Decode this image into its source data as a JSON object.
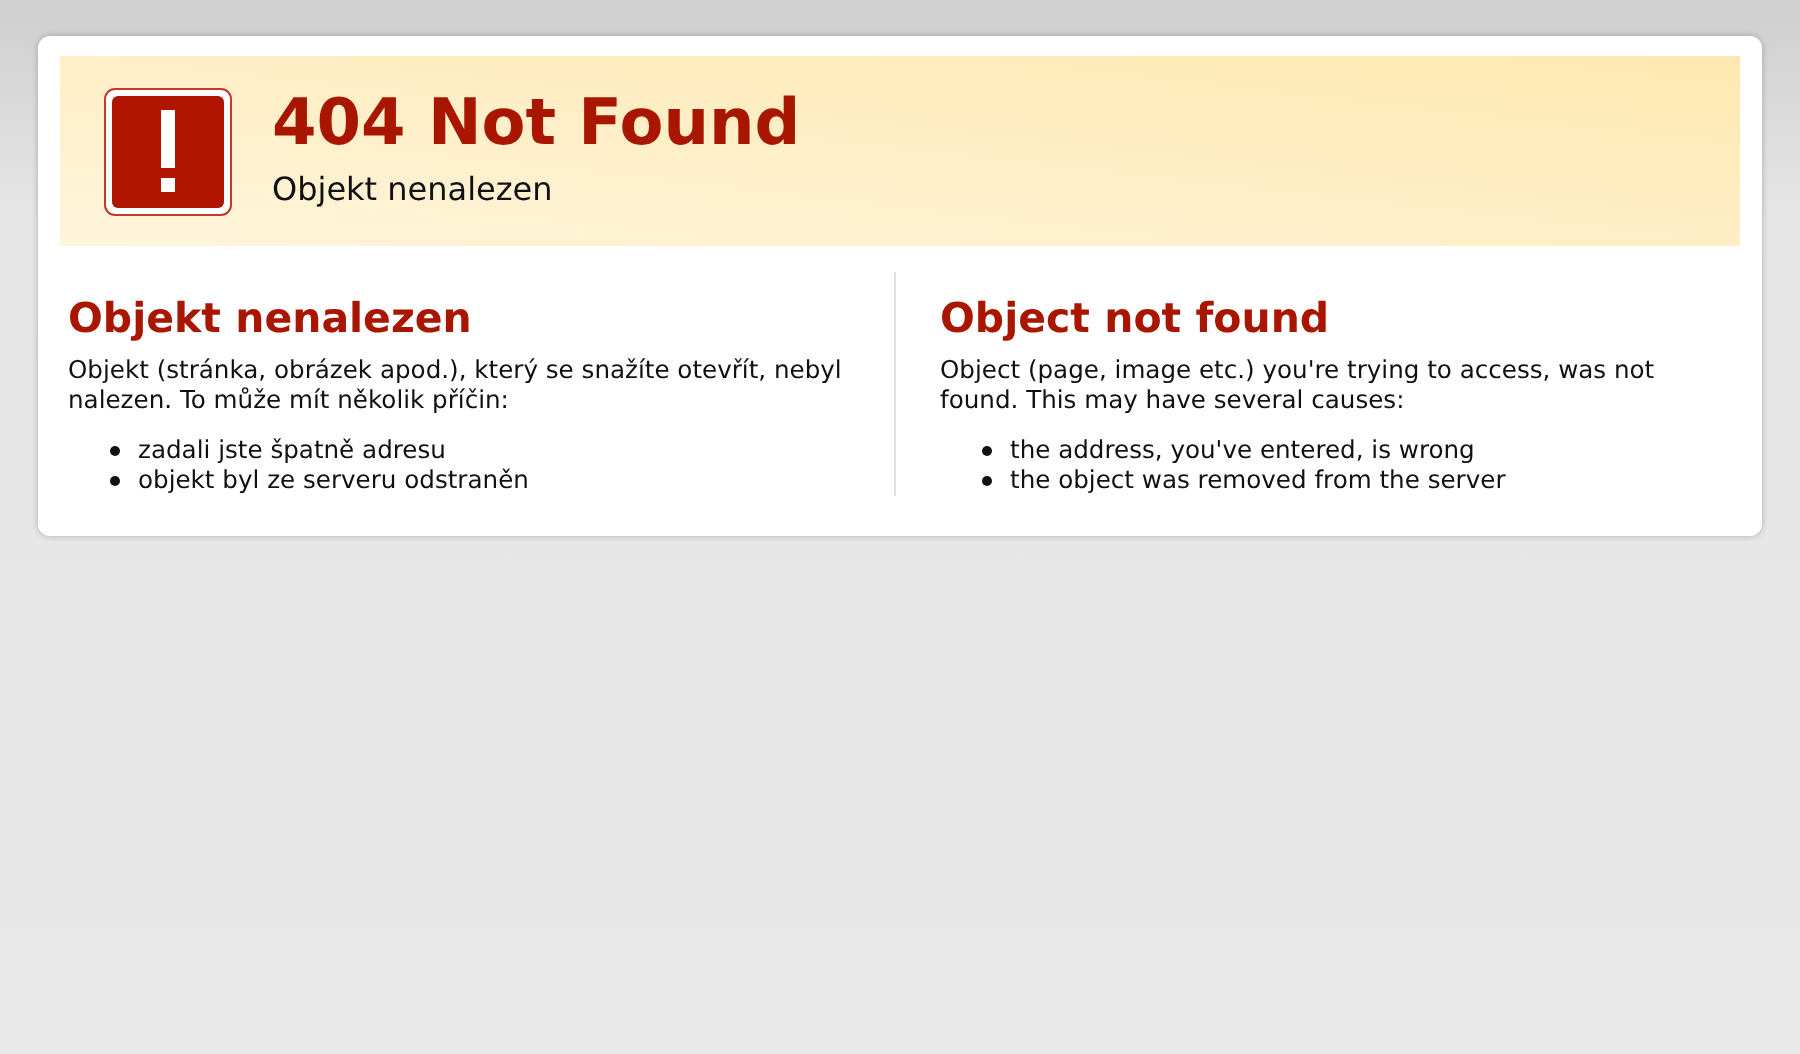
{
  "header": {
    "title": "404 Not Found",
    "subtitle": "Objekt nenalezen"
  },
  "sections": [
    {
      "heading": "Objekt nenalezen",
      "text": "Objekt (stránka, obrázek apod.), který se snažíte otevřít, nebyl nalezen. To může mít několik příčin:",
      "causes": [
        "zadali jste špatně adresu",
        "objekt byl ze serveru odstraněn"
      ]
    },
    {
      "heading": "Object not found",
      "text": "Object (page, image etc.) you're trying to access, was not found. This may have several causes:",
      "causes": [
        "the address, you've entered, is wrong",
        "the object was removed from the server"
      ]
    }
  ]
}
